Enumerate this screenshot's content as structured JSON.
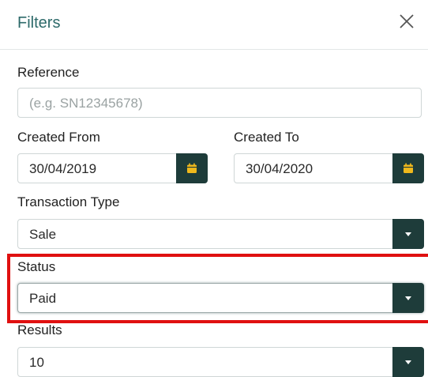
{
  "header": {
    "title": "Filters"
  },
  "reference": {
    "label": "Reference",
    "placeholder": "(e.g. SN12345678)",
    "value": ""
  },
  "created_from": {
    "label": "Created From",
    "value": "30/04/2019",
    "button_icon": "calendar-icon"
  },
  "created_to": {
    "label": "Created To",
    "value": "30/04/2020",
    "button_icon": "calendar-icon"
  },
  "transaction_type": {
    "label": "Transaction Type",
    "value": "Sale",
    "button_icon": "chevron-down-icon"
  },
  "status": {
    "label": "Status",
    "value": "Paid",
    "button_icon": "chevron-down-icon"
  },
  "results": {
    "label": "Results",
    "value": "10",
    "button_icon": "chevron-down-icon"
  },
  "colors": {
    "title": "#2d6a6a",
    "button_bg": "#1e3c3a",
    "calendar_icon": "#f0b81c",
    "highlight": "#e01010"
  }
}
